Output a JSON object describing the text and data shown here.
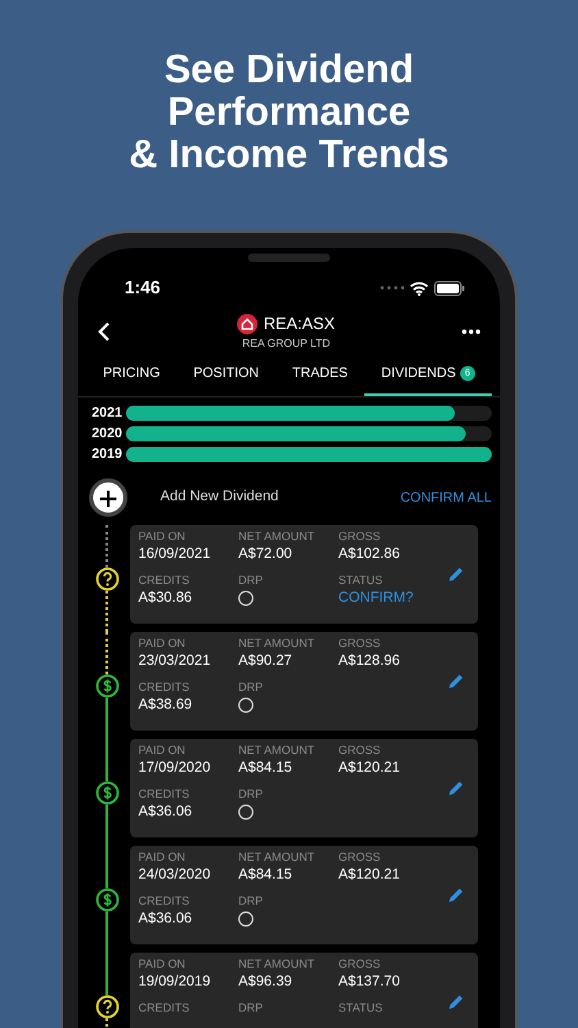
{
  "headline": "See Dividend\nPerformance\n& Income Trends",
  "status_bar": {
    "time": "1:46"
  },
  "header": {
    "ticker": "REA:ASX",
    "company": "REA GROUP LTD"
  },
  "tabs": [
    {
      "label": "PRICING",
      "selected": false
    },
    {
      "label": "POSITION",
      "selected": false
    },
    {
      "label": "TRADES",
      "selected": false
    },
    {
      "label": "DIVIDENDS",
      "selected": true,
      "badge": "6"
    }
  ],
  "year_bars": [
    {
      "label": "2021",
      "level": 0.9
    },
    {
      "label": "2020",
      "level": 0.93
    },
    {
      "label": "2019",
      "level": 1
    }
  ],
  "add_dividend": {
    "label": "Add New Dividend",
    "action": "CONFIRM ALL"
  },
  "dividends": [
    {
      "kind": "pending",
      "top": [
        {
          "label": "PAID ON",
          "value": "16/09/2021"
        },
        {
          "label": "NET AMOUNT",
          "value": "A$72.00"
        },
        {
          "label": "GROSS",
          "value": "A$102.86"
        }
      ],
      "bottom": [
        {
          "kind": "text",
          "label": "CREDITS",
          "value": "A$30.86"
        },
        {
          "kind": "check",
          "label": "DRP",
          "checked": false
        },
        {
          "kind": "link",
          "label": "STATUS",
          "value": "CONFIRM?"
        }
      ]
    },
    {
      "kind": "paid",
      "top": [
        {
          "label": "PAID ON",
          "value": "23/03/2021"
        },
        {
          "label": "NET AMOUNT",
          "value": "A$90.27"
        },
        {
          "label": "GROSS",
          "value": "A$128.96"
        }
      ],
      "bottom": [
        {
          "kind": "text",
          "label": "CREDITS",
          "value": "A$38.69"
        },
        {
          "kind": "check",
          "label": "DRP",
          "checked": false
        }
      ]
    },
    {
      "kind": "paid",
      "top": [
        {
          "label": "PAID ON",
          "value": "17/09/2020"
        },
        {
          "label": "NET AMOUNT",
          "value": "A$84.15"
        },
        {
          "label": "GROSS",
          "value": "A$120.21"
        }
      ],
      "bottom": [
        {
          "kind": "text",
          "label": "CREDITS",
          "value": "A$36.06"
        },
        {
          "kind": "check",
          "label": "DRP",
          "checked": false
        }
      ]
    },
    {
      "kind": "paid",
      "top": [
        {
          "label": "PAID ON",
          "value": "24/03/2020"
        },
        {
          "label": "NET AMOUNT",
          "value": "A$84.15"
        },
        {
          "label": "GROSS",
          "value": "A$120.21"
        }
      ],
      "bottom": [
        {
          "kind": "text",
          "label": "CREDITS",
          "value": "A$36.06"
        },
        {
          "kind": "check",
          "label": "DRP",
          "checked": false
        }
      ]
    },
    {
      "kind": "pending",
      "top": [
        {
          "label": "PAID ON",
          "value": "19/09/2019"
        },
        {
          "label": "NET AMOUNT",
          "value": "A$96.39"
        },
        {
          "label": "GROSS",
          "value": "A$137.70"
        }
      ],
      "bottom": [
        {
          "kind": "text",
          "label": "CREDITS"
        },
        {
          "kind": "check",
          "label": "DRP"
        },
        {
          "kind": "link",
          "label": "STATUS"
        }
      ]
    }
  ]
}
